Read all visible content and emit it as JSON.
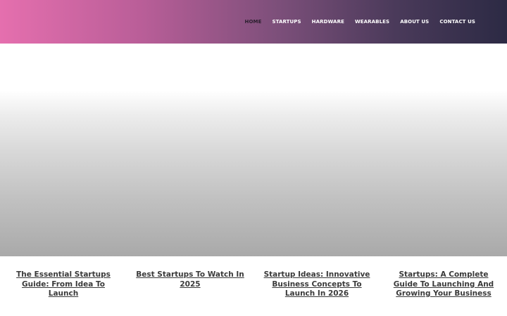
{
  "nav": {
    "items": [
      {
        "label": "HOME",
        "active": true
      },
      {
        "label": "STARTUPS",
        "active": false
      },
      {
        "label": "HARDWARE",
        "active": false
      },
      {
        "label": "WEARABLES",
        "active": false
      },
      {
        "label": "ABOUT US",
        "active": false
      },
      {
        "label": "CONTACT US",
        "active": false
      }
    ]
  },
  "header": {
    "gradient_colors": [
      "#e56fae",
      "#b95e98",
      "#7c4f7a",
      "#4a3a5a",
      "#2c2a44"
    ]
  },
  "posts": [
    {
      "title": "The Essential Startups Guide: From Idea To Launch"
    },
    {
      "title": "Best Startups To Watch In 2025"
    },
    {
      "title": "Startup Ideas: Innovative Business Concepts To Launch In 2026"
    },
    {
      "title": "Startups: A Complete Guide To Launching And Growing Your Business"
    }
  ]
}
